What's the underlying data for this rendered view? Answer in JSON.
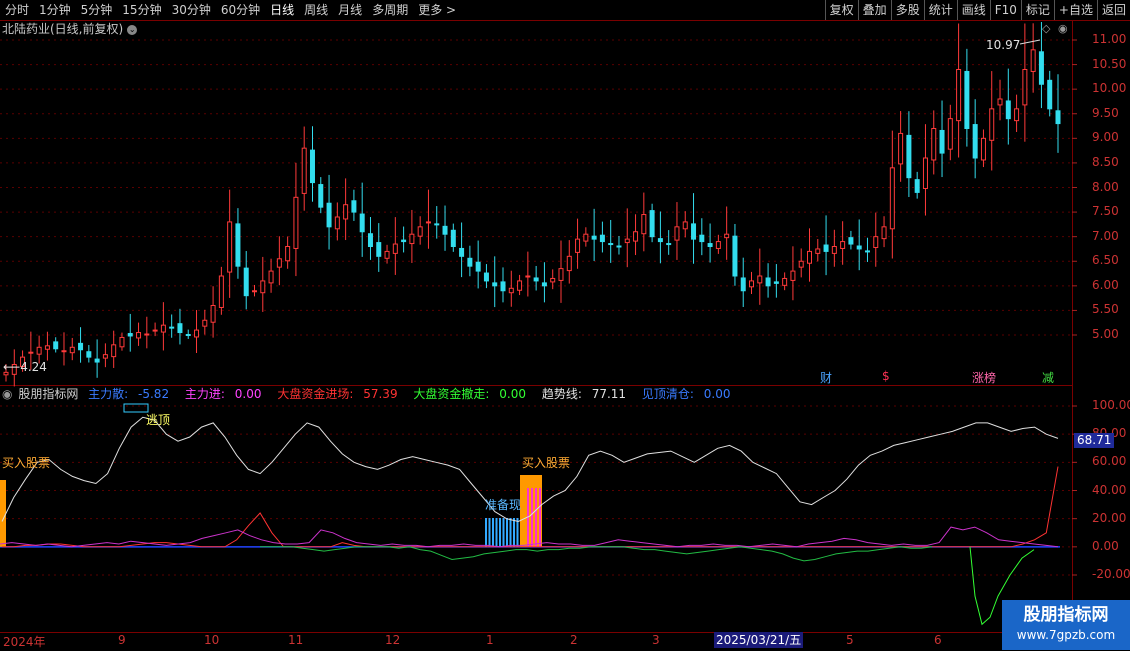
{
  "toolbar": {
    "timeframes": [
      "分时",
      "1分钟",
      "5分钟",
      "15分钟",
      "30分钟",
      "60分钟",
      "日线",
      "周线",
      "月线",
      "多周期",
      "更多 >"
    ],
    "right_buttons": [
      "复权",
      "叠加",
      "多股",
      "统计",
      "画线",
      "F10",
      "+自选",
      "返回"
    ],
    "marker_label": "标记"
  },
  "main": {
    "title": "北陆药业(日线,前复权)",
    "price_high": "10.97",
    "price_low": "4.24",
    "price_ticks": [
      "11.00",
      "10.50",
      "10.00",
      "9.50",
      "9.00",
      "8.50",
      "8.00",
      "7.50",
      "7.00",
      "6.50",
      "6.00",
      "5.50",
      "5.00"
    ],
    "event_tags": [
      {
        "text": "财",
        "color": "#4aa3ff"
      },
      {
        "text": "$",
        "color": "#ff3355"
      },
      {
        "text": "涨榜",
        "color": "#ff66aa"
      },
      {
        "text": "减",
        "color": "#44dd44"
      }
    ]
  },
  "indicator": {
    "name": "股朋指标网",
    "fields": [
      {
        "label": "主力散:",
        "value": "-5.82",
        "color": "#3a7bff"
      },
      {
        "label": "主力进:",
        "value": "0.00",
        "color": "#ff44ff"
      },
      {
        "label": "大盘资金进场:",
        "value": "57.39",
        "color": "#ff3333"
      },
      {
        "label": "大盘资金撤走:",
        "value": "0.00",
        "color": "#33ff33"
      },
      {
        "label": "趋势线:",
        "value": "77.11",
        "color": "#e0e0e0"
      },
      {
        "label": "见顶清仓:",
        "value": "0.00",
        "color": "#3a7bff"
      }
    ],
    "ticks": [
      "100.00",
      "80.00",
      "60.00",
      "40.00",
      "20.00",
      "0.00",
      "-20.00"
    ],
    "current_value": "68.71",
    "signals": {
      "buy1": "买入股票",
      "buy2": "买入股票",
      "escape": "逃顶",
      "prepare": "准备现"
    }
  },
  "xaxis": {
    "labels": [
      "2024年",
      "9",
      "10",
      "11",
      "12",
      "1",
      "2",
      "3",
      "5",
      "6"
    ],
    "cursor_date": "2025/03/21/五"
  },
  "watermark": {
    "name": "股朋指标网",
    "url": "www.7gpzb.com"
  },
  "chart_data": [
    {
      "type": "candlestick",
      "title": "北陆药业(日线,前复权)",
      "ylim": [
        4.2,
        11.2
      ],
      "series": [
        {
          "name": "close",
          "values": [
            4.24,
            4.4,
            4.55,
            4.65,
            4.75,
            4.78,
            4.72,
            4.68,
            4.75,
            4.7,
            4.55,
            4.45,
            4.6,
            4.8,
            4.95,
            4.98,
            5.05,
            5.02,
            5.1,
            5.2,
            5.15,
            5.05,
            5.0,
            5.1,
            5.3,
            5.6,
            6.2,
            7.3,
            6.4,
            5.8,
            5.9,
            6.1,
            6.3,
            6.55,
            6.8,
            7.8,
            8.8,
            8.1,
            7.6,
            7.2,
            7.4,
            7.65,
            7.5,
            7.1,
            6.8,
            6.6,
            6.7,
            6.85,
            6.9,
            7.05,
            7.2,
            7.3,
            7.25,
            7.05,
            6.8,
            6.6,
            6.4,
            6.3,
            6.1,
            6.0,
            5.9,
            5.95,
            6.1,
            6.2,
            6.1,
            6.0,
            6.15,
            6.35,
            6.6,
            6.95,
            7.05,
            6.95,
            6.9,
            6.85,
            6.8,
            6.95,
            7.1,
            7.45,
            7.0,
            6.9,
            6.85,
            7.2,
            7.3,
            6.95,
            6.9,
            6.8,
            6.9,
            7.05,
            6.2,
            5.9,
            6.1,
            6.2,
            6.0,
            6.05,
            6.15,
            6.3,
            6.5,
            6.7,
            6.75,
            6.7,
            6.8,
            6.9,
            6.85,
            6.75,
            6.7,
            7.0,
            7.2,
            8.4,
            9.1,
            8.2,
            7.9,
            8.6,
            9.2,
            8.7,
            9.4,
            10.4,
            9.2,
            8.6,
            9.0,
            9.6,
            9.8,
            9.4,
            9.6,
            10.4,
            10.8,
            10.1,
            9.6,
            9.3
          ]
        }
      ]
    },
    {
      "type": "line",
      "title": "股朋指标网",
      "ylim": [
        -30,
        110
      ],
      "series": [
        {
          "name": "趋势线",
          "values": [
            18,
            35,
            48,
            60,
            62,
            55,
            50,
            47,
            45,
            52,
            70,
            85,
            92,
            90,
            80,
            75,
            78,
            85,
            88,
            78,
            65,
            55,
            52,
            60,
            70,
            80,
            88,
            85,
            75,
            66,
            60,
            57,
            55,
            58,
            62,
            64,
            62,
            60,
            58,
            55,
            45,
            35,
            25,
            20,
            18,
            22,
            30,
            36,
            40,
            50,
            65,
            68,
            65,
            60,
            63,
            66,
            67,
            68,
            64,
            60,
            65,
            70,
            72,
            68,
            60,
            56,
            52,
            42,
            32,
            30,
            35,
            40,
            48,
            58,
            65,
            68,
            72,
            74,
            76,
            78,
            80,
            82,
            85,
            88,
            88,
            85,
            82,
            84,
            85,
            80,
            77
          ],
          "color": "#e0e0e0"
        },
        {
          "name": "大盘资金进场",
          "values": [
            0,
            0,
            1,
            1,
            2,
            2,
            1,
            0,
            0,
            0,
            0,
            1,
            2,
            3,
            3,
            2,
            1,
            0,
            0,
            0,
            5,
            15,
            24,
            10,
            0,
            0,
            0,
            0,
            0,
            3,
            1,
            0,
            0,
            0,
            0,
            0,
            0,
            0,
            0,
            0,
            0,
            0,
            0,
            0,
            0,
            0,
            0,
            0,
            0,
            0,
            0,
            0,
            0,
            0,
            0,
            0,
            0,
            0,
            0,
            0,
            0,
            0,
            0,
            0,
            0,
            0,
            0,
            0,
            0,
            0,
            0,
            0,
            0,
            0,
            0,
            0,
            0,
            0,
            0,
            0,
            0,
            0,
            0,
            0,
            0,
            0,
            0,
            2,
            5,
            10,
            57
          ],
          "color": "#ff3333"
        }
      ]
    }
  ]
}
